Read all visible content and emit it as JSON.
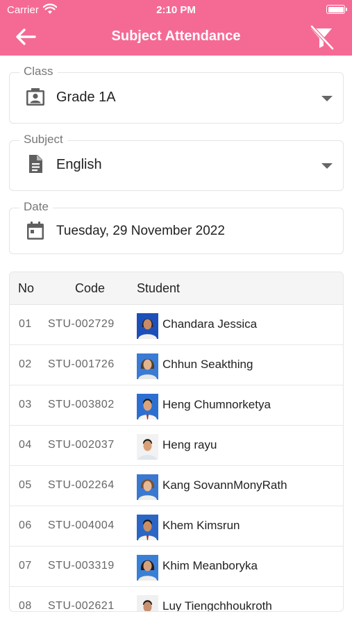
{
  "status_bar": {
    "carrier": "Carrier",
    "time": "2:10 PM"
  },
  "app_bar": {
    "title": "Subject Attendance"
  },
  "colors": {
    "accent": "#f56a95"
  },
  "filters": {
    "class": {
      "label": "Class",
      "value": "Grade 1A",
      "icon": "person-card-icon"
    },
    "subject": {
      "label": "Subject",
      "value": "English",
      "icon": "document-icon"
    },
    "date": {
      "label": "Date",
      "value": "Tuesday, 29 November 2022",
      "icon": "calendar-icon"
    }
  },
  "table": {
    "headers": {
      "no": "No",
      "code": "Code",
      "student": "Student"
    },
    "rows": [
      {
        "no": "01",
        "code": "STU-002729",
        "name": "Chandara Jessica"
      },
      {
        "no": "02",
        "code": "STU-001726",
        "name": "Chhun Seakthing"
      },
      {
        "no": "03",
        "code": "STU-003802",
        "name": "Heng Chumnorketya"
      },
      {
        "no": "04",
        "code": "STU-002037",
        "name": "Heng rayu"
      },
      {
        "no": "05",
        "code": "STU-002264",
        "name": "Kang SovannMonyRath"
      },
      {
        "no": "06",
        "code": "STU-004004",
        "name": "Khem Kimsrun"
      },
      {
        "no": "07",
        "code": "STU-003319",
        "name": "Khim Meanboryka"
      },
      {
        "no": "08",
        "code": "STU-002621",
        "name": "Luy Tiengchhoukroth"
      }
    ]
  }
}
